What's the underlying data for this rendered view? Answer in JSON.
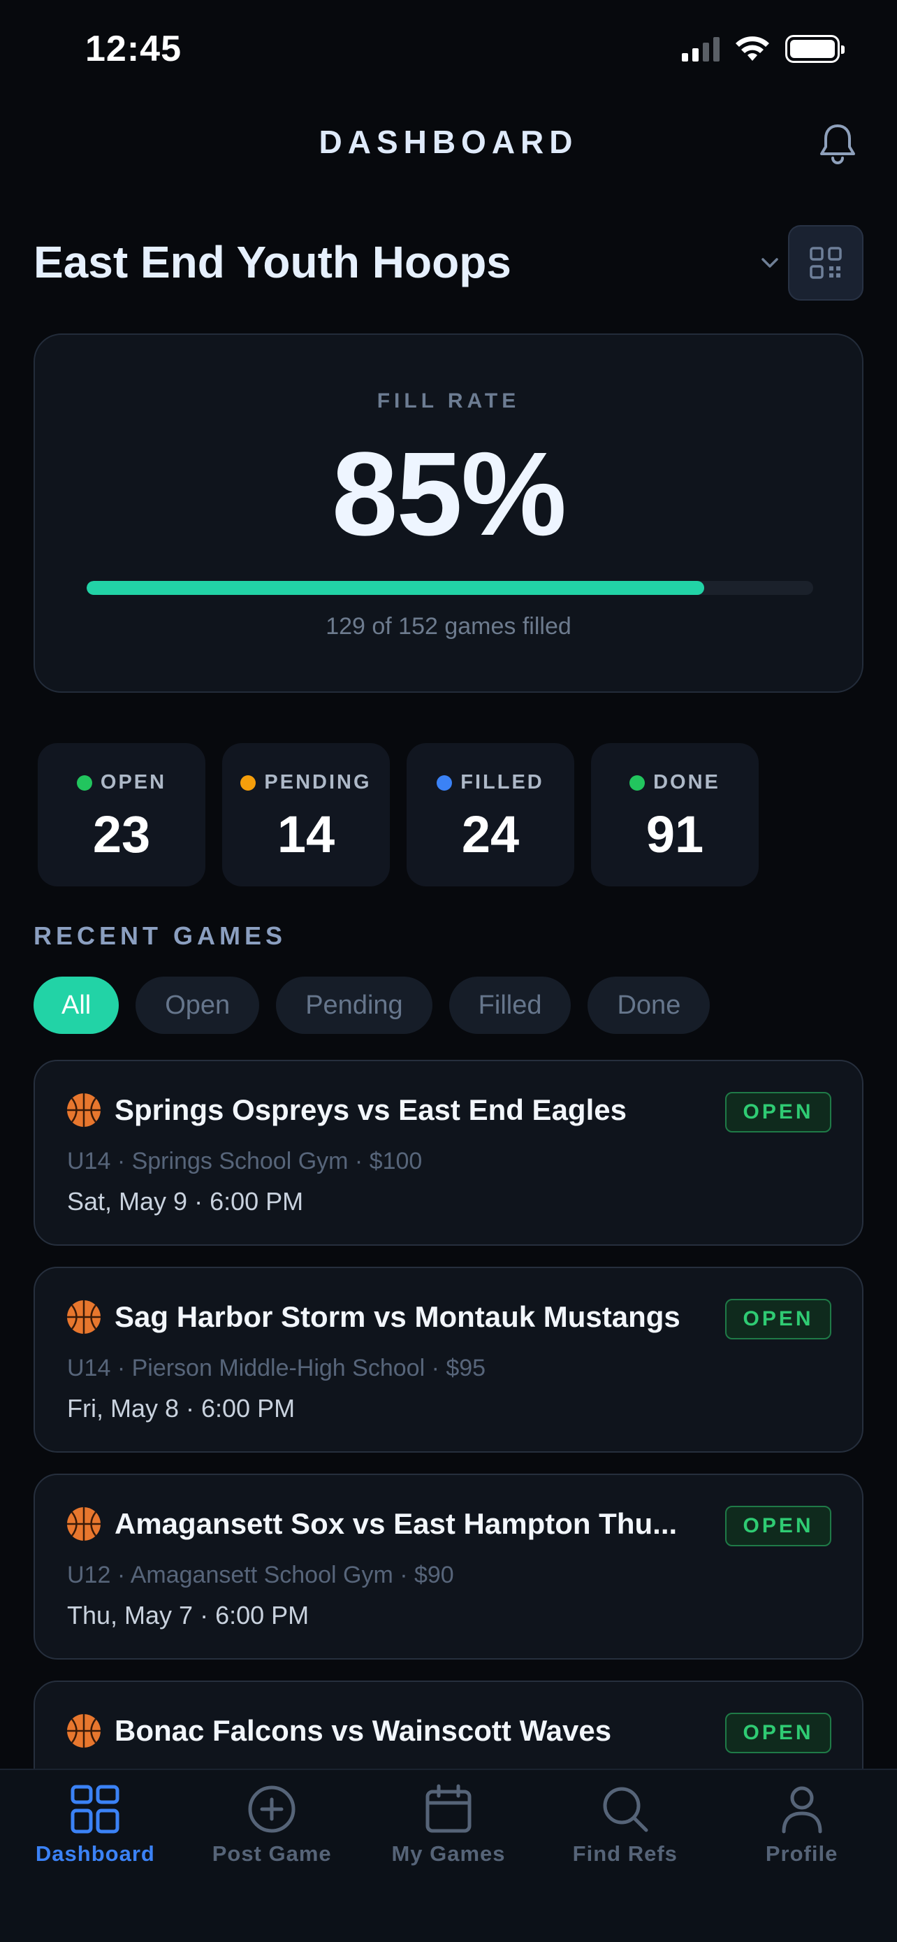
{
  "status_bar": {
    "time": "12:45"
  },
  "header": {
    "title": "DASHBOARD"
  },
  "org": {
    "name": "East End Youth Hoops"
  },
  "fill_rate": {
    "label": "FILL RATE",
    "value": "85%",
    "progress_fraction": 0.85,
    "caption": "129 of 152 games filled"
  },
  "stats": [
    {
      "label": "OPEN",
      "value": "23",
      "color": "#22c55e"
    },
    {
      "label": "PENDING",
      "value": "14",
      "color": "#f59e0b"
    },
    {
      "label": "FILLED",
      "value": "24",
      "color": "#3b82f6"
    },
    {
      "label": "DONE",
      "value": "91",
      "color": "#22c55e"
    }
  ],
  "recent": {
    "title": "RECENT GAMES",
    "filters": [
      "All",
      "Open",
      "Pending",
      "Filled",
      "Done"
    ],
    "active_filter": "All"
  },
  "games": [
    {
      "title": "Springs Ospreys vs East End Eagles",
      "meta": "U14 · Springs School Gym · $100",
      "date": "Sat, May 9 · 6:00 PM",
      "status": "OPEN"
    },
    {
      "title": "Sag Harbor Storm vs Montauk Mustangs",
      "meta": "U14 · Pierson Middle-High School · $95",
      "date": "Fri, May 8 · 6:00 PM",
      "status": "OPEN"
    },
    {
      "title": "Amagansett Sox vs East Hampton Thu...",
      "meta": "U12 · Amagansett School Gym · $90",
      "date": "Thu, May 7 · 6:00 PM",
      "status": "OPEN"
    },
    {
      "title": "Bonac Falcons vs Wainscott Waves",
      "meta": "",
      "date": "",
      "status": "OPEN"
    }
  ],
  "tabs": [
    {
      "label": "Dashboard",
      "icon": "grid-icon",
      "active": true
    },
    {
      "label": "Post Game",
      "icon": "plus-circle-icon",
      "active": false
    },
    {
      "label": "My Games",
      "icon": "calendar-icon",
      "active": false
    },
    {
      "label": "Find Refs",
      "icon": "search-icon",
      "active": false
    },
    {
      "label": "Profile",
      "icon": "person-icon",
      "active": false
    }
  ],
  "colors": {
    "accent": "#22d3a6",
    "tab_active": "#3b82f6",
    "badge_open": "#2fcb73"
  }
}
